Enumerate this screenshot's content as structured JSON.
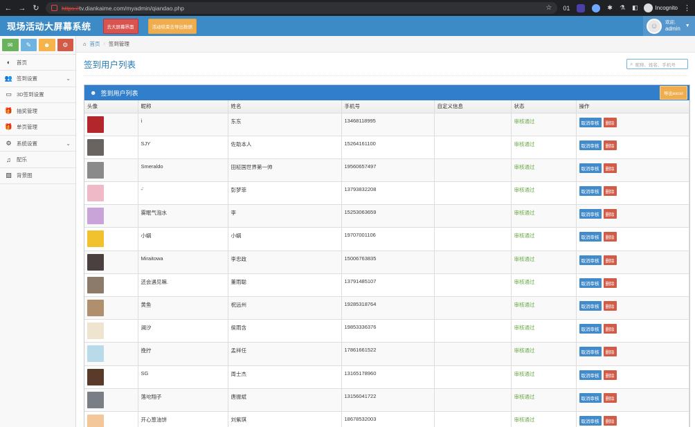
{
  "browser": {
    "url_https": "https://",
    "url_rest": "tv.diankaime.com/myadmin/qiandao.php",
    "ext_count": "01",
    "incognito_label": "Incognito"
  },
  "header": {
    "title": "现场活动大屏幕系统",
    "btn_screen": "去大屏幕界面",
    "btn_export": "活动结束去导出数据",
    "welcome": "欢迎,",
    "username": "admin"
  },
  "sidebar": {
    "items": [
      {
        "label": "首页",
        "icon": "dashboard-icon",
        "glyph": "◐",
        "chevron": false
      },
      {
        "label": "签到设置",
        "icon": "users-icon",
        "glyph": "👥",
        "chevron": true
      },
      {
        "label": "3D签到设置",
        "icon": "desktop-icon",
        "glyph": "▭",
        "chevron": false
      },
      {
        "label": "抽奖管理",
        "icon": "gift-icon",
        "glyph": "🎁",
        "chevron": false
      },
      {
        "label": "单页管理",
        "icon": "gift-icon",
        "glyph": "🎁",
        "chevron": false
      },
      {
        "label": "系统设置",
        "icon": "gear-icon",
        "glyph": "⚙",
        "chevron": true
      },
      {
        "label": "配乐",
        "icon": "music-icon",
        "glyph": "♫",
        "chevron": false
      },
      {
        "label": "背景图",
        "icon": "picture-icon",
        "glyph": "▨",
        "chevron": false
      }
    ]
  },
  "breadcrumb": {
    "home": "首页",
    "current": "签到管理"
  },
  "page": {
    "title": "签到用户列表",
    "search_placeholder": "昵称、姓名、手机号"
  },
  "widget": {
    "title": "签到用户列表",
    "export_label": "导出excel"
  },
  "table": {
    "headers": [
      "头像",
      "昵称",
      "姓名",
      "手机号",
      "自定义信息",
      "状态",
      "操作"
    ],
    "approve_cancel": "取消审核",
    "delete": "删除",
    "rows": [
      {
        "nickname": "i",
        "name": "东东",
        "phone": "13468118995",
        "custom": "",
        "status": "审核通过",
        "color": "#b3262b"
      },
      {
        "nickname": "SJY",
        "name": "佐助本人",
        "phone": "15264161100",
        "custom": "",
        "status": "审核通过",
        "color": "#6a6460"
      },
      {
        "nickname": "Smeraldo",
        "name": "田柾国世界第一帅",
        "phone": "19560657497",
        "custom": "",
        "status": "审核通过",
        "color": "#8a8a8a"
      },
      {
        "nickname": "ᵕ̈",
        "name": "彭梦菲",
        "phone": "13793832208",
        "custom": "",
        "status": "审核通过",
        "color": "#f0b9c8"
      },
      {
        "nickname": "雾眠气泡水",
        "name": "李",
        "phone": "15253063659",
        "custom": "",
        "status": "审核通过",
        "color": "#c9a4d9"
      },
      {
        "nickname": "小蜗",
        "name": "小蜗",
        "phone": "19707001106",
        "custom": "",
        "status": "审核通过",
        "color": "#f2c12e"
      },
      {
        "nickname": "Miraitowa",
        "name": "李忠政",
        "phone": "15006763835",
        "custom": "",
        "status": "审核通过",
        "color": "#4a4040"
      },
      {
        "nickname": "还会遇见嘛.",
        "name": "董雨聪",
        "phone": "13791485107",
        "custom": "",
        "status": "审核通过",
        "color": "#8c7a6a"
      },
      {
        "nickname": "黄鱼",
        "name": "祝远州",
        "phone": "19285318764",
        "custom": "",
        "status": "审核通过",
        "color": "#b08f6f"
      },
      {
        "nickname": "澜汐",
        "name": "侯雨含",
        "phone": "19853336376",
        "custom": "",
        "status": "审核通过",
        "color": "#efe4cf"
      },
      {
        "nickname": "挽拧",
        "name": "孟祥任",
        "phone": "17861661522",
        "custom": "",
        "status": "审核通过",
        "color": "#b9dbe9"
      },
      {
        "nickname": "SG",
        "name": "周士杰",
        "phone": "13165178960",
        "custom": "",
        "status": "审核通过",
        "color": "#5a3a28"
      },
      {
        "nickname": "落坨翔子",
        "name": "唐振斌",
        "phone": "13156041722",
        "custom": "",
        "status": "审核通过",
        "color": "#7a7f86"
      },
      {
        "nickname": "开心葱油饼",
        "name": "刘紫琪",
        "phone": "18678532003",
        "custom": "",
        "status": "审核通过",
        "color": "#f3c79a"
      }
    ]
  }
}
